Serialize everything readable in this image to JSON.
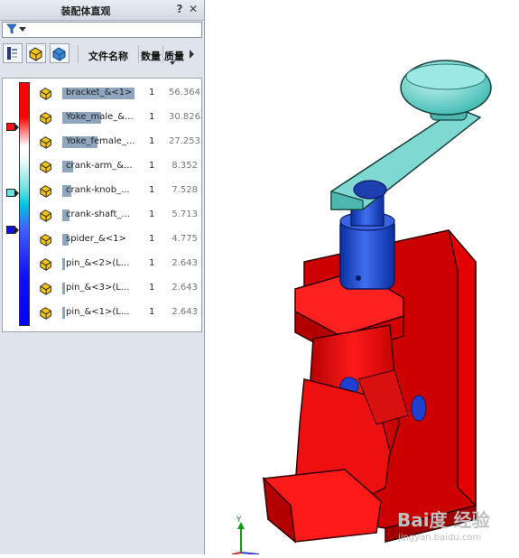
{
  "panel": {
    "title": "装配体直观",
    "help_label": "?",
    "close_label": "✕",
    "filter_icon": "funnel-icon",
    "columns": {
      "name": "文件名称",
      "qty": "数量",
      "mass": "质量"
    }
  },
  "parts": [
    {
      "name": "bracket_&<1>",
      "qty": "1",
      "mass": "56.364",
      "fill": 0.93
    },
    {
      "name": "Yoke_male_&...",
      "qty": "1",
      "mass": "30.826",
      "fill": 0.5
    },
    {
      "name": "Yoke_female_...",
      "qty": "1",
      "mass": "27.253",
      "fill": 0.45
    },
    {
      "name": "crank-arm_&...",
      "qty": "1",
      "mass": "8.352",
      "fill": 0.14
    },
    {
      "name": "crank-knob_...",
      "qty": "1",
      "mass": "7.528",
      "fill": 0.12
    },
    {
      "name": "crank-shaft_...",
      "qty": "1",
      "mass": "5.713",
      "fill": 0.09
    },
    {
      "name": "spider_&<1>",
      "qty": "1",
      "mass": "4.775",
      "fill": 0.08
    },
    {
      "name": "pin_&<2>(L...",
      "qty": "1",
      "mass": "2.643",
      "fill": 0.04
    },
    {
      "name": "pin_&<3>(L...",
      "qty": "1",
      "mass": "2.643",
      "fill": 0.04
    },
    {
      "name": "pin_&<1>(L...",
      "qty": "1",
      "mass": "2.643",
      "fill": 0.04
    }
  ],
  "colors": {
    "high": "#ff0000",
    "mid": "#66e0e0",
    "low": "#0000ff",
    "bar": "#8fa6bf"
  },
  "viewport": {
    "axis_label": "Y",
    "watermark": "Bai度 经验",
    "watermark_sub": "jingyan.baidu.com"
  }
}
